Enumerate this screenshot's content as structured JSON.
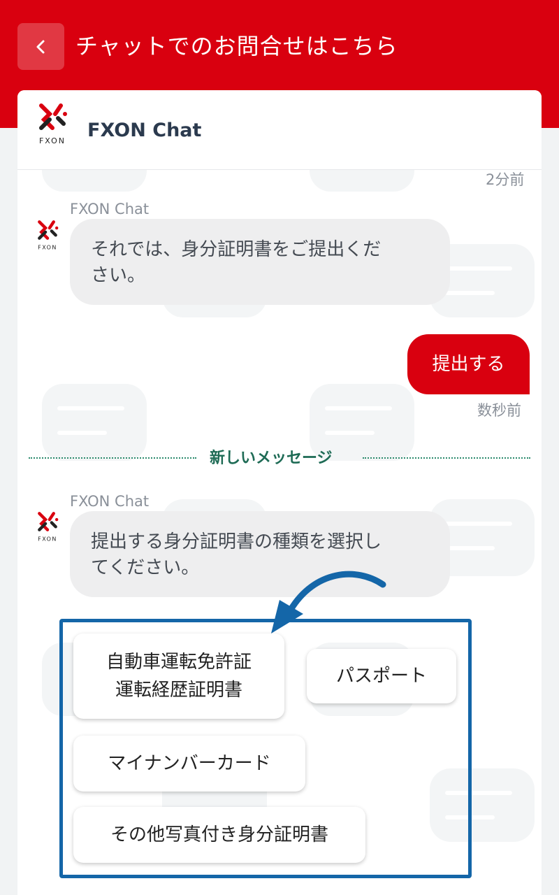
{
  "header": {
    "title": "チャットでのお問合せはこちら",
    "back_icon": "chevron-left-icon",
    "color": "#d9000f"
  },
  "chat": {
    "name": "FXON Chat",
    "logo_text": "FXON"
  },
  "messages": [
    {
      "timestamp": "2分前"
    },
    {
      "sender": "FXON Chat",
      "text_lines": [
        "それでは、身分証明書をご提出くだ",
        "さい。"
      ]
    },
    {
      "user_text": "提出する",
      "timestamp": "数秒前"
    },
    {
      "divider": "新しいメッセージ"
    },
    {
      "sender": "FXON Chat",
      "text_lines": [
        "提出する身分証明書の種類を選択し",
        "てください。"
      ]
    }
  ],
  "options": {
    "license": [
      "自動車運転免許証",
      "運転経歴証明書"
    ],
    "passport": "パスポート",
    "mynumber": "マイナンバーカード",
    "other": "その他写真付き身分証明書"
  },
  "colors": {
    "accent": "#d9000f",
    "highlight": "#1466a8",
    "divider": "#1e6b55"
  }
}
